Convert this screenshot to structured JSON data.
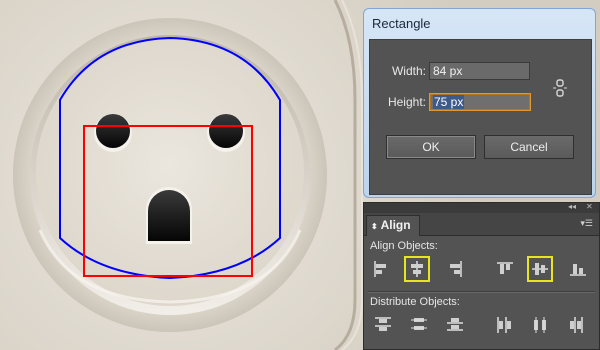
{
  "dialog": {
    "title": "Rectangle",
    "width_label": "Width:",
    "width_value": "84 px",
    "height_label": "Height:",
    "height_value": "75 px",
    "ok_label": "OK",
    "cancel_label": "Cancel",
    "link_icon": "link-constrain-icon"
  },
  "panel": {
    "tab_label": "Align",
    "tab_icon": "panel-collapse-arrows-icon",
    "align_objects_label": "Align Objects:",
    "distribute_objects_label": "Distribute Objects:",
    "align_buttons": [
      {
        "name": "horizontal-align-left-icon",
        "selected": false
      },
      {
        "name": "horizontal-align-center-icon",
        "selected": true
      },
      {
        "name": "horizontal-align-right-icon",
        "selected": false
      },
      {
        "name": "vertical-align-top-icon",
        "selected": false
      },
      {
        "name": "vertical-align-center-icon",
        "selected": true
      },
      {
        "name": "vertical-align-bottom-icon",
        "selected": false
      }
    ],
    "distribute_buttons": [
      {
        "name": "vertical-distribute-top-icon"
      },
      {
        "name": "vertical-distribute-center-icon"
      },
      {
        "name": "vertical-distribute-bottom-icon"
      },
      {
        "name": "horizontal-distribute-left-icon"
      },
      {
        "name": "horizontal-distribute-center-icon"
      },
      {
        "name": "horizontal-distribute-right-icon"
      }
    ],
    "highlight_color": "#e6e61e"
  },
  "artwork": {
    "blue_path_color": "#0000ff",
    "red_rect_color": "#ff0000"
  }
}
